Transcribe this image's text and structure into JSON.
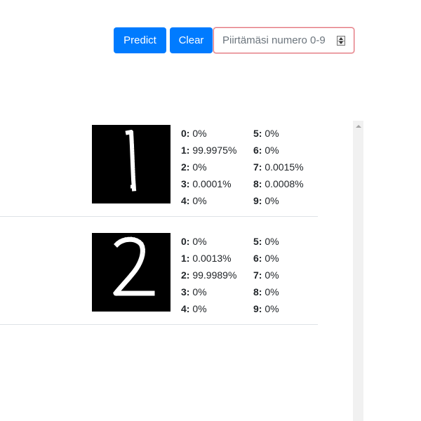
{
  "toolbar": {
    "predict_label": "Predict",
    "clear_label": "Clear",
    "number_input": {
      "placeholder": "Piirtämäsi numero 0-9",
      "value": ""
    }
  },
  "results": [
    {
      "drawn_digit": "1",
      "probabilities": [
        {
          "digit": "0:",
          "value": "0%"
        },
        {
          "digit": "1:",
          "value": "99.9975%"
        },
        {
          "digit": "2:",
          "value": "0%"
        },
        {
          "digit": "3:",
          "value": "0.0001%"
        },
        {
          "digit": "4:",
          "value": "0%"
        },
        {
          "digit": "5:",
          "value": "0%"
        },
        {
          "digit": "6:",
          "value": "0%"
        },
        {
          "digit": "7:",
          "value": "0.0015%"
        },
        {
          "digit": "8:",
          "value": "0.0008%"
        },
        {
          "digit": "9:",
          "value": "0%"
        }
      ]
    },
    {
      "drawn_digit": "2",
      "probabilities": [
        {
          "digit": "0:",
          "value": "0%"
        },
        {
          "digit": "1:",
          "value": "0.0013%"
        },
        {
          "digit": "2:",
          "value": "99.9989%"
        },
        {
          "digit": "3:",
          "value": "0%"
        },
        {
          "digit": "4:",
          "value": "0%"
        },
        {
          "digit": "5:",
          "value": "0%"
        },
        {
          "digit": "6:",
          "value": "0%"
        },
        {
          "digit": "7:",
          "value": "0%"
        },
        {
          "digit": "8:",
          "value": "0%"
        },
        {
          "digit": "9:",
          "value": "0%"
        }
      ]
    }
  ],
  "icons": {
    "spinner": "number-spinner-icon",
    "scroll_up": "scroll-up-arrow-icon"
  },
  "colors": {
    "button": "#007bff",
    "input_invalid_border": "#e2747b",
    "image_background": "#000000",
    "stroke": "#ffffff"
  }
}
